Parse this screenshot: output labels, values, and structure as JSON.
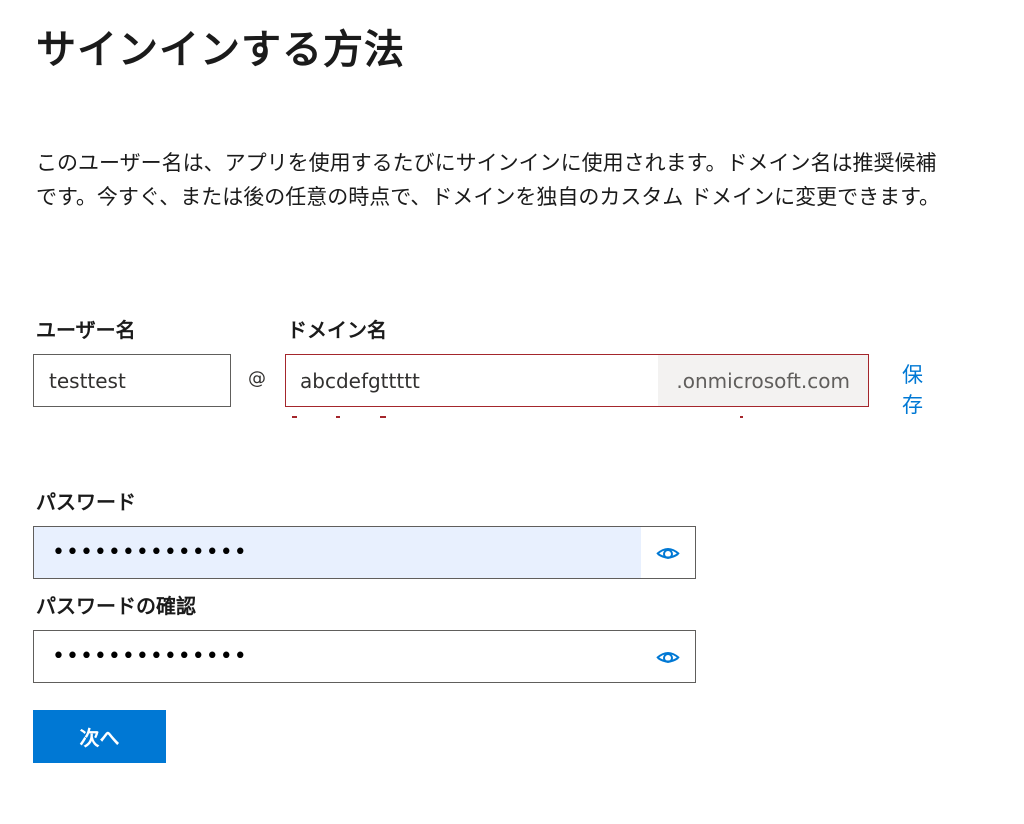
{
  "page": {
    "title": "サインインする方法",
    "description": "このユーザー名は、アプリを使用するたびにサインインに使用されます。ドメイン名は推奨候補です。今すぐ、または後の任意の時点で、ドメインを独自のカスタム ドメインに変更できます。"
  },
  "username": {
    "label": "ユーザー名",
    "value": "testtest",
    "at": "@"
  },
  "domain": {
    "label": "ドメイン名",
    "value": "abcdefgttttt",
    "suffix": ".onmicrosoft.com",
    "save": "保存",
    "error_color": "#a4262c"
  },
  "password": {
    "label": "パスワード",
    "value": "••••••••••••••",
    "icon": "eye-icon"
  },
  "confirm_password": {
    "label": "パスワードの確認",
    "value": "••••••••••••••",
    "icon": "eye-icon"
  },
  "buttons": {
    "next": "次へ"
  },
  "colors": {
    "accent": "#0078d4",
    "autofill": "#e8f0fe",
    "suffix_bg": "#f3f2f1"
  }
}
